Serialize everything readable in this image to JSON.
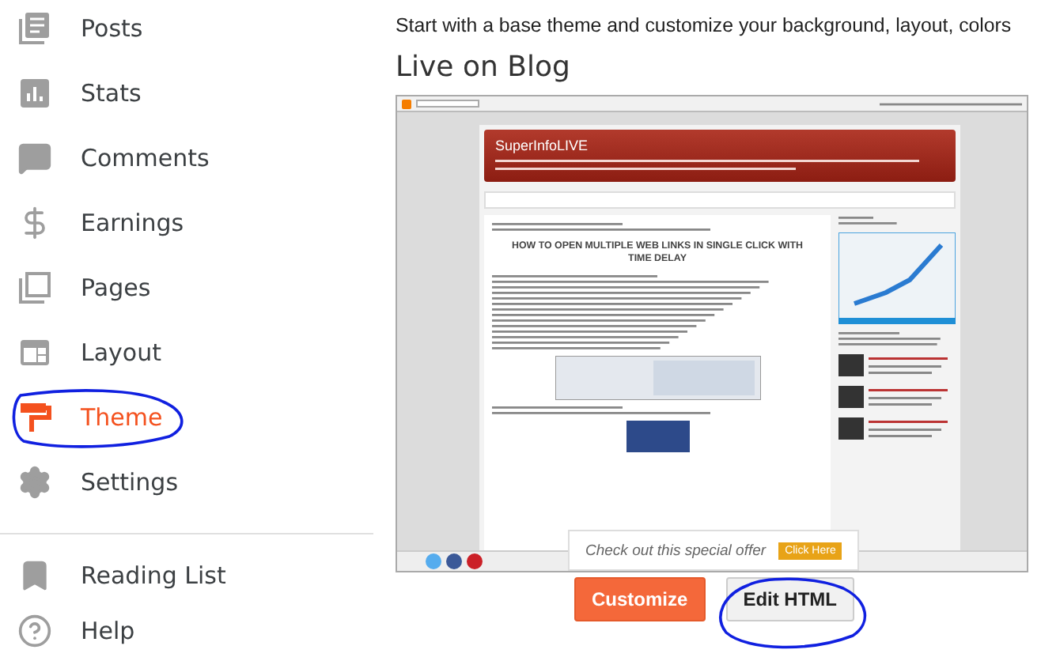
{
  "sidebar": {
    "items": [
      {
        "label": "Posts",
        "kind": "posts",
        "selected": false
      },
      {
        "label": "Stats",
        "kind": "stats",
        "selected": false
      },
      {
        "label": "Comments",
        "kind": "comments",
        "selected": false
      },
      {
        "label": "Earnings",
        "kind": "earnings",
        "selected": false
      },
      {
        "label": "Pages",
        "kind": "pages",
        "selected": false
      },
      {
        "label": "Layout",
        "kind": "layout",
        "selected": false
      },
      {
        "label": "Theme",
        "kind": "theme",
        "selected": true
      },
      {
        "label": "Settings",
        "kind": "settings",
        "selected": false
      }
    ],
    "secondary": [
      {
        "label": "Reading List",
        "kind": "bookmark",
        "selected": false
      },
      {
        "label": "Help",
        "kind": "help",
        "selected": false
      }
    ]
  },
  "intro": "Start with a base theme and customize your background, layout, colors",
  "section_title": "Live on Blog",
  "preview": {
    "blog_title": "SuperInfoLIVE",
    "post_title": "HOW TO OPEN MULTIPLE WEB LINKS IN SINGLE CLICK WITH TIME DELAY",
    "offer": {
      "text": "Check out this special offer",
      "button": "Click Here"
    }
  },
  "buttons": [
    {
      "label": "Customize",
      "kind": "primary"
    },
    {
      "label": "Edit HTML",
      "kind": "secondary"
    }
  ]
}
